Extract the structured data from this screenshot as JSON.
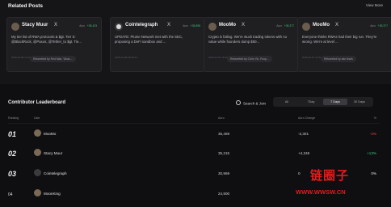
{
  "related_posts": {
    "title": "Related Posts",
    "view_more": "View More",
    "cards": [
      {
        "name": "Stacy Muur",
        "x_label": "X",
        "meta": "Auro",
        "change": "+35,423",
        "text": "My tier list of RWA protocols & $gt. Tier S: @BlackRock, @Paxos, @Tether_to $gt. Tie...",
        "date": "2025-02-08 12:12:21",
        "retweet": "Retweeted by Red Man, Vikas ..."
      },
      {
        "name": "Cointelegraph",
        "x_label": "X",
        "meta": "Auro",
        "change": "+35,898",
        "text": "UPDATE: Plume Network met with the SEC, proposing a DeFi sandbox and ...",
        "date": "2025-02-08 09:35:21",
        "retweet": ""
      },
      {
        "name": "MooMo",
        "x_label": "X",
        "meta": "Auro",
        "change": "+35,377",
        "text": "Crypto is failing. We're stuck trading tokens with no value while founders dump $50...",
        "date": "2025-02-07 18:12:04",
        "retweet": "Retweeted by Chris Yin, Poop..."
      },
      {
        "name": "MooMo",
        "x_label": "X",
        "meta": "Auro",
        "change": "+35,377",
        "text": "Everyone thinks RWAs had their big run. They're wrong. We're at level ...",
        "date": "2025-02-07 10:41:55",
        "retweet": "Retweeted by dan lewis"
      }
    ]
  },
  "leaderboard": {
    "title": "Contributor Leaderboard",
    "search_label": "Search & Join",
    "tabs": [
      "All",
      "7Day",
      "7 Days",
      "30 Days"
    ],
    "active_tab": 2,
    "headers": {
      "ranking": "Ranking",
      "user": "User",
      "auro": "Auro",
      "auro_change": "Auro Change",
      "pct": "%"
    },
    "rows": [
      {
        "rank": "01",
        "user": "MooMo",
        "auro": "35,469",
        "change": "-2,301",
        "pct": "-2%"
      },
      {
        "rank": "02",
        "user": "Stacy Muur",
        "auro": "35,215",
        "change": "+4,345",
        "pct": "+13%"
      },
      {
        "rank": "03",
        "user": "Cointelegraph",
        "auro": "30,969",
        "change": "0",
        "pct": "0%"
      },
      {
        "rank": "04",
        "user": "MoonKing",
        "auro": "24,900",
        "change": "",
        "pct": ""
      }
    ]
  },
  "watermark": {
    "text": "链圈子",
    "url": "WWW.WWSW.CN"
  },
  "colors": {
    "background": "#0d0d0f",
    "card": "#1f1f22",
    "positive": "#3fc27a",
    "negative": "#e24b4b",
    "watermark": "#e31b1b"
  }
}
